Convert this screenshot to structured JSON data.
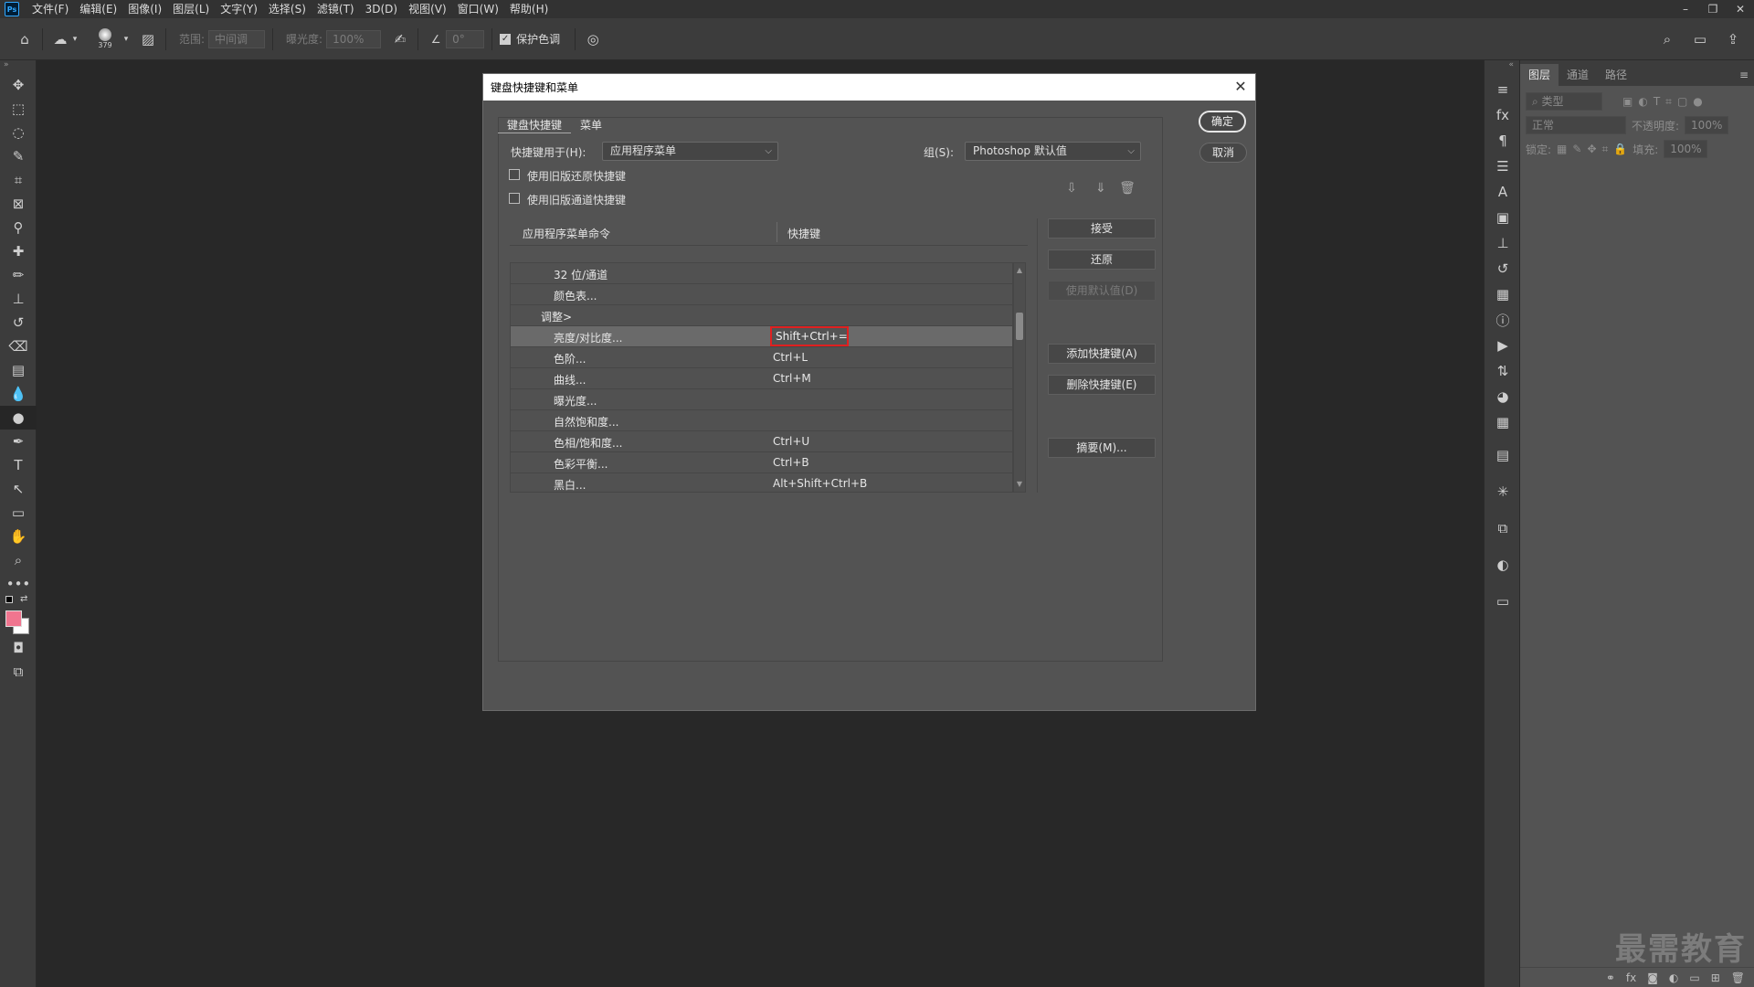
{
  "app": {
    "logo": "Ps",
    "menu": [
      "文件(F)",
      "编辑(E)",
      "图像(I)",
      "图层(L)",
      "文字(Y)",
      "选择(S)",
      "滤镜(T)",
      "3D(D)",
      "视图(V)",
      "窗口(W)",
      "帮助(H)"
    ],
    "window_controls": [
      "–",
      "❐",
      "✕"
    ]
  },
  "options_bar": {
    "brush_size": "379",
    "range_label": "范围:",
    "range_value": "中间调",
    "exposure_label": "曝光度:",
    "exposure_value": "100%",
    "angle_value": "0°",
    "protect_tones_label": "保护色调",
    "protect_tones_checked": true
  },
  "right_panel": {
    "tabs": [
      "图层",
      "通道",
      "路径"
    ],
    "active_tab": "图层",
    "filter_placeholder": "类型",
    "blend_mode": "正常",
    "opacity_label": "不透明度:",
    "opacity_value": "100%",
    "lock_label": "锁定:",
    "fill_label": "填充:",
    "fill_value": "100%",
    "watermark": "最需教育"
  },
  "dialog": {
    "title": "键盘快捷键和菜单",
    "tabs": [
      "键盘快捷键",
      "菜单"
    ],
    "active_tab": "键盘快捷键",
    "shortcuts_for_label": "快捷键用于(H):",
    "shortcuts_for_value": "应用程序菜单",
    "set_label": "组(S):",
    "set_value": "Photoshop 默认值",
    "legacy_undo_label": "使用旧版还原快捷键",
    "legacy_undo_checked": false,
    "legacy_channel_label": "使用旧版通道快捷键",
    "legacy_channel_checked": false,
    "col_command": "应用程序菜单命令",
    "col_shortcut": "快捷键",
    "rows": [
      {
        "name": "32 位/通道",
        "indent": 2,
        "key": ""
      },
      {
        "name": "颜色表...",
        "indent": 2,
        "key": ""
      },
      {
        "name": "调整>",
        "indent": 1,
        "key": ""
      },
      {
        "name": "亮度/对比度...",
        "indent": 2,
        "key": "Shift+Ctrl+=",
        "selected": true
      },
      {
        "name": "色阶...",
        "indent": 2,
        "key": "Ctrl+L"
      },
      {
        "name": "曲线...",
        "indent": 2,
        "key": "Ctrl+M"
      },
      {
        "name": "曝光度...",
        "indent": 2,
        "key": ""
      },
      {
        "name": "自然饱和度...",
        "indent": 2,
        "key": ""
      },
      {
        "name": "色相/饱和度...",
        "indent": 2,
        "key": "Ctrl+U"
      },
      {
        "name": "色彩平衡...",
        "indent": 2,
        "key": "Ctrl+B"
      },
      {
        "name": "黑白...",
        "indent": 2,
        "key": "Alt+Shift+Ctrl+B"
      }
    ],
    "buttons": {
      "ok": "确定",
      "cancel": "取消",
      "accept": "接受",
      "undo": "还原",
      "use_default": "使用默认值(D)",
      "add_shortcut": "添加快捷键(A)",
      "delete_shortcut": "删除快捷键(E)",
      "summarize": "摘要(M)..."
    }
  }
}
